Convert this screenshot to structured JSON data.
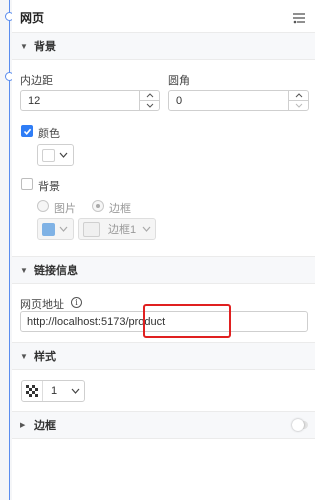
{
  "header": {
    "title": "网页",
    "menu_icon": "menu-settings-icon"
  },
  "sections": {
    "background": {
      "title": "背景"
    },
    "link": {
      "title": "链接信息"
    },
    "style": {
      "title": "样式"
    },
    "border": {
      "title": "边框"
    }
  },
  "padding": {
    "label": "内边距",
    "value": "12"
  },
  "radius": {
    "label": "圆角",
    "value": "0"
  },
  "color": {
    "label": "颜色",
    "checked": true,
    "swatch": "#ffffff"
  },
  "bg": {
    "label": "背景",
    "checked": false,
    "image_label": "图片",
    "border_label": "边框",
    "selected_radio": "border",
    "swatch": "#7fb2e5",
    "border_select_value": "边框1"
  },
  "link": {
    "url_label": "网页地址",
    "url_value": "http://localhost:5173/product"
  },
  "style": {
    "select_value": "1",
    "icon": "checker-pattern-icon"
  },
  "colors": {
    "accent": "#2f7df6",
    "highlight": "#e02020",
    "canvas_line": "#5b8def"
  }
}
